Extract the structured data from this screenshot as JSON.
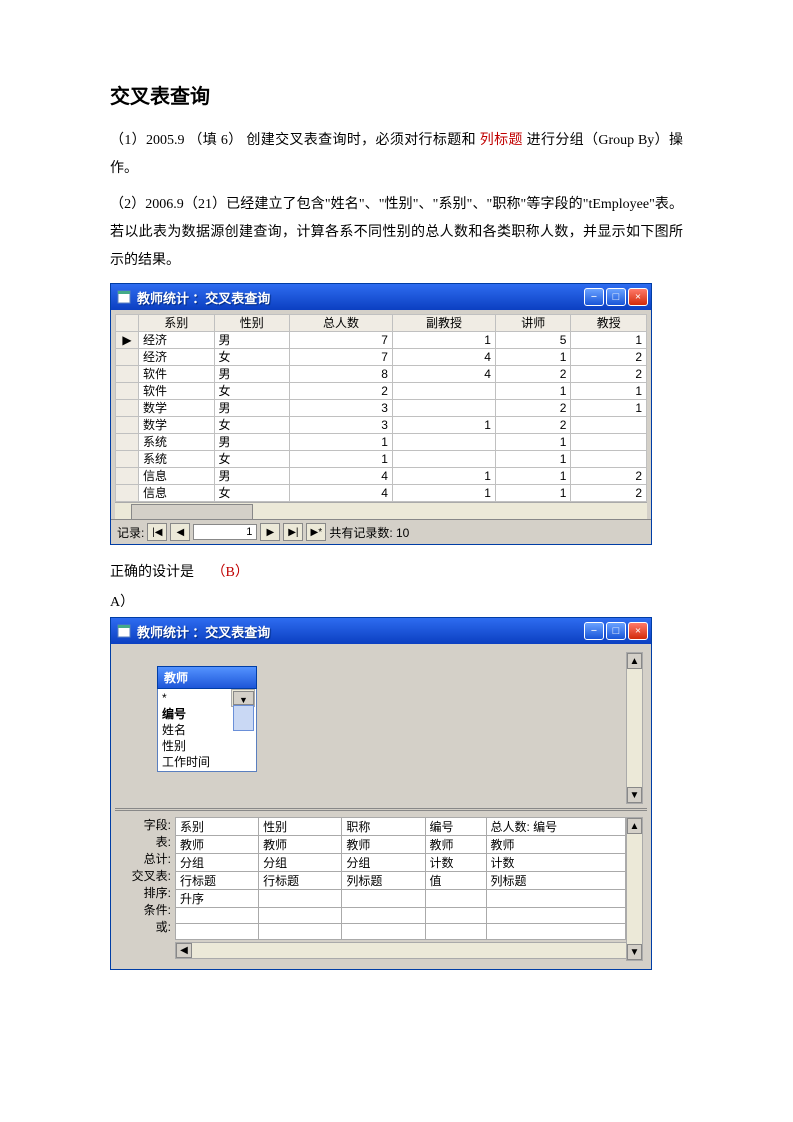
{
  "heading": "交叉表查询",
  "p1_a": "（1）2005.9 （填 6） 创建交叉表查询时，必须对行标题和 ",
  "p1_red": "列标题",
  "p1_b": " 进行分组（Group By）操作。",
  "p2": "（2）2006.9（21）已经建立了包含\"姓名\"、\"性别\"、\"系别\"、\"职称\"等字段的\"tEmployee\"表。若以此表为数据源创建查询，计算各系不同性别的总人数和各类职称人数，并显示如下图所示的结果。",
  "win1": {
    "title": "教师统计 ：交叉表查询",
    "headers": [
      "系别",
      "性别",
      "总人数",
      "副教授",
      "讲师",
      "教授"
    ],
    "rows": [
      [
        "经济",
        "男",
        "7",
        "1",
        "5",
        "1"
      ],
      [
        "经济",
        "女",
        "7",
        "4",
        "1",
        "2"
      ],
      [
        "软件",
        "男",
        "8",
        "4",
        "2",
        "2"
      ],
      [
        "软件",
        "女",
        "2",
        "",
        "1",
        "1"
      ],
      [
        "数学",
        "男",
        "3",
        "",
        "2",
        "1"
      ],
      [
        "数学",
        "女",
        "3",
        "1",
        "2",
        ""
      ],
      [
        "系统",
        "男",
        "1",
        "",
        "1",
        ""
      ],
      [
        "系统",
        "女",
        "1",
        "",
        "1",
        ""
      ],
      [
        "信息",
        "男",
        "4",
        "1",
        "1",
        "2"
      ],
      [
        "信息",
        "女",
        "4",
        "1",
        "1",
        "2"
      ]
    ],
    "nav_label": "记录:",
    "nav_value": "1",
    "nav_total": "共有记录数: 10"
  },
  "p3_a": "正确的设计是　",
  "p3_red": "（B）",
  "p4": "A）",
  "win2": {
    "title": "教师统计 ：交叉表查询",
    "field_title": "教师",
    "fields": [
      "*",
      "编号",
      "姓名",
      "性别",
      "工作时间"
    ],
    "bold_field": "编号",
    "qbe_labels": [
      "字段:",
      "表:",
      "总计:",
      "交叉表:",
      "排序:",
      "条件:",
      "或:"
    ],
    "qbe_rows": [
      [
        "系别",
        "性别",
        "职称",
        "编号",
        "总人数: 编号"
      ],
      [
        "教师",
        "教师",
        "教师",
        "教师",
        "教师"
      ],
      [
        "分组",
        "分组",
        "分组",
        "计数",
        "计数"
      ],
      [
        "行标题",
        "行标题",
        "列标题",
        "值",
        "列标题"
      ],
      [
        "升序",
        "",
        "",
        "",
        ""
      ],
      [
        "",
        "",
        "",
        "",
        ""
      ],
      [
        "",
        "",
        "",
        "",
        ""
      ]
    ]
  }
}
